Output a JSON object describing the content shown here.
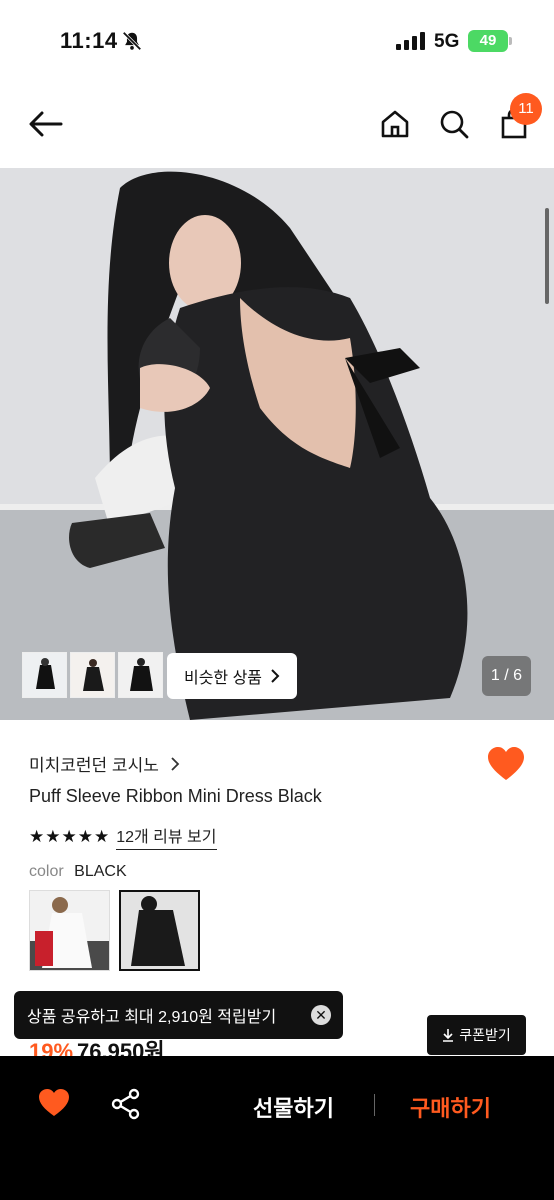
{
  "status_bar": {
    "time": "11:14",
    "network": "5G",
    "battery": "49"
  },
  "header": {
    "cart_count": "11"
  },
  "gallery": {
    "similar_label": "비슷한 상품",
    "pager": "1 / 6"
  },
  "product": {
    "brand": "미치코런던 코시노",
    "name": "Puff Sleeve Ribbon Mini Dress Black",
    "rating_stars": "★★★★★",
    "review_link": "12개 리뷰 보기",
    "color_label": "color",
    "color_value": "BLACK",
    "discount": "19%",
    "price": "76,950원"
  },
  "toast": {
    "message": "상품 공유하고 최대 2,910원 적립받기"
  },
  "coupon": {
    "label": "쿠폰받기"
  },
  "bottom_bar": {
    "gift_label": "선물하기",
    "buy_label": "구매하기"
  },
  "colors": {
    "accent": "#ff5a1f",
    "battery": "#4cd964"
  },
  "icons": [
    "bell-slash-icon",
    "signal-icon",
    "back-arrow-icon",
    "home-icon",
    "search-icon",
    "shopping-bag-icon",
    "chevron-right-icon",
    "heart-icon",
    "close-icon",
    "download-icon",
    "share-icon"
  ]
}
